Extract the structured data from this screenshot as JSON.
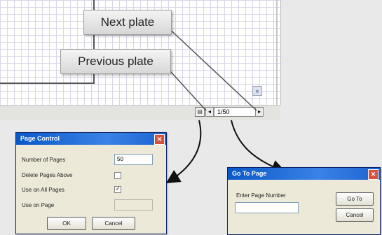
{
  "callouts": {
    "next_plate": "Next plate",
    "previous_plate": "Previous plate"
  },
  "statusbar": {
    "page_indicator": "1/50",
    "prev_symbol": "◂",
    "next_symbol": "▸",
    "page_icon": "▤"
  },
  "scroll_right_symbol": "»",
  "page_control": {
    "title": "Page Control",
    "close": "✕",
    "rows": [
      {
        "label": "Number of Pages",
        "value": "50"
      },
      {
        "label": "Delete Pages Above",
        "checked": false
      },
      {
        "label": "Use on All Pages",
        "checked": true,
        "mark": "✓"
      },
      {
        "label": "Use on Page",
        "value": ""
      }
    ],
    "ok_label": "OK",
    "cancel_label": "Cancel"
  },
  "goto_page": {
    "title": "Go To Page",
    "close": "✕",
    "prompt": "Enter Page Number",
    "value": "",
    "goto_label": "Go To",
    "cancel_label": "Cancel"
  },
  "colors": {
    "titlebar": "#0a58c8",
    "dialog_bg": "#ece9d8",
    "grid": "#d7d7e8"
  }
}
